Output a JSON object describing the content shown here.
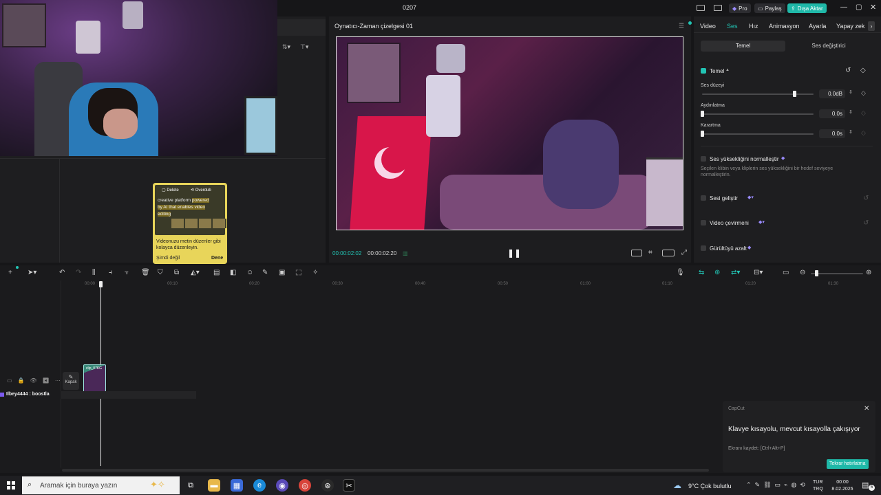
{
  "titlebar": {
    "title": "0207",
    "pro": "Pro",
    "share": "Paylaş",
    "export": "Dışa Aktar"
  },
  "player": {
    "title": "Oynatıcı-Zaman çizelgesi 01",
    "current_time": "00:00:02:02",
    "total_time": "00:00:02:20"
  },
  "inspector": {
    "tabs": [
      "Video",
      "Ses",
      "Hız",
      "Animasyon",
      "Ayarla",
      "Yapay zek"
    ],
    "active_tab": "Ses",
    "subtabs": {
      "basic": "Temel",
      "changer": "Ses değiştirici"
    },
    "section_basic": "Temel",
    "volume": {
      "label": "Ses düzeyi",
      "value": "0.0dB",
      "level": 0.83
    },
    "fade_in": {
      "label": "Aydınlatma",
      "value": "0.0s",
      "level": 0.0
    },
    "fade_out": {
      "label": "Karartma",
      "value": "0.0s",
      "level": 0.0
    },
    "normalize": {
      "label": "Ses yüksekliğini normalleştir",
      "desc": "Seçilen klibin veya kliplerin ses yüksekliğini bir hedef seviyeye normalleştirin."
    },
    "enhance": "Sesi geliştir",
    "translate": "Video çevirmeni",
    "denoise": "Gürültüyü azalt"
  },
  "tipcard": {
    "btn_delete": "Delete",
    "btn_overdub": "Overdub",
    "text1": "creative platform",
    "text2": "powered",
    "text3": "by AI that enables video",
    "text4": "editing",
    "caption": "Videonuzu metin düzenler gibi kolayca düzenleyin.",
    "later": "Şimdi değil",
    "try": "Dene"
  },
  "timeline": {
    "ticks": [
      "00:00",
      "00:10",
      "00:20",
      "00:30",
      "00:40",
      "00:50",
      "01:00",
      "01:10",
      "01:20",
      "01:30"
    ],
    "cover_label": "Kapak",
    "clip_label": "clip_07KG",
    "chat_message": "Ilbey4444 : boostla"
  },
  "notification": {
    "app": "CapCut",
    "title": "Klavye kısayolu, mevcut kısayolla çakışıyor",
    "subtitle": "Ekranı kaydet: [Ctrl+Alt+P]",
    "button": "Tekrar hatırlatma"
  },
  "taskbar": {
    "search_placeholder": "Aramak için buraya yazın",
    "weather": "9°C  Çok bulutlu",
    "lang1": "TUR",
    "lang2": "TRQ",
    "time": "00:00",
    "date": "8.02.2026",
    "notif_count": "5"
  },
  "colors": {
    "accent": "#22c4b4",
    "export_btn": "#1fb8a8",
    "tip_bg": "#e8d55a"
  }
}
